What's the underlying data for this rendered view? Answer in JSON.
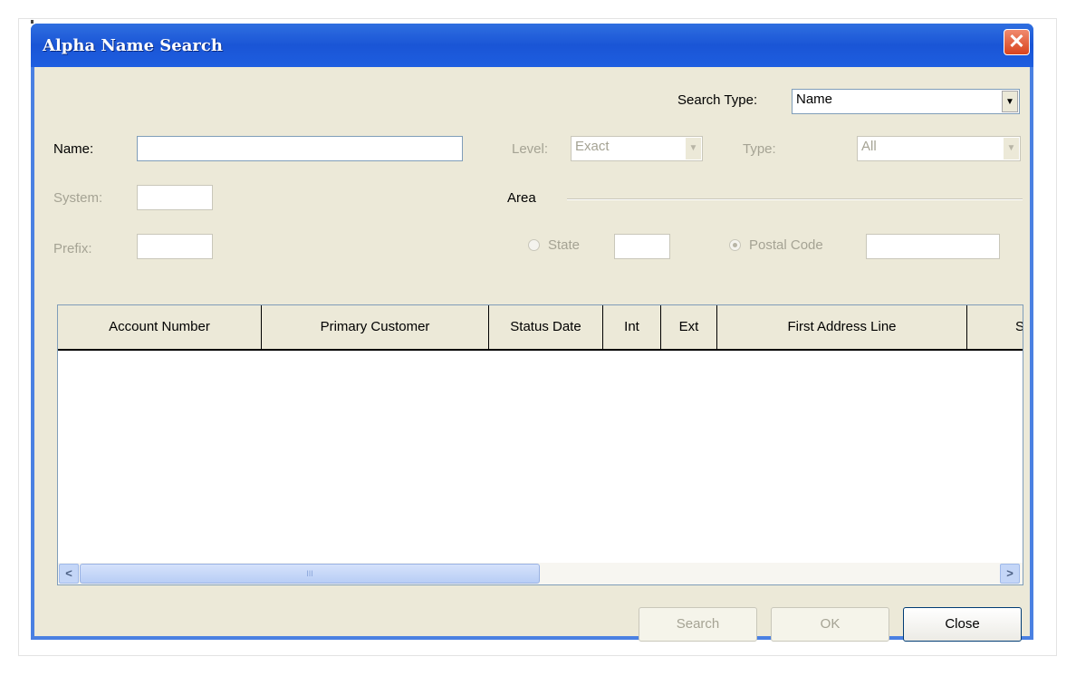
{
  "window": {
    "title": "Alpha Name Search",
    "close_glyph": "✕"
  },
  "search_type": {
    "label": "Search Type:",
    "value": "Name"
  },
  "name": {
    "label": "Name:",
    "value": ""
  },
  "level": {
    "label": "Level:",
    "value": "Exact"
  },
  "type": {
    "label": "Type:",
    "value": "All"
  },
  "system": {
    "label": "System:",
    "value": ""
  },
  "prefix": {
    "label": "Prefix:",
    "value": ""
  },
  "area": {
    "label": "Area",
    "state": {
      "label": "State",
      "value": "",
      "checked": false
    },
    "postal_code": {
      "label": "Postal Code",
      "value": "",
      "checked": true
    }
  },
  "grid": {
    "columns": [
      "Account Number",
      "Primary Customer",
      "Status Date",
      "Int",
      "Ext",
      "First Address Line",
      "S"
    ],
    "rows": []
  },
  "scroll": {
    "left": "<",
    "right": ">",
    "grip": "III"
  },
  "buttons": {
    "search": "Search",
    "ok": "OK",
    "close": "Close"
  }
}
